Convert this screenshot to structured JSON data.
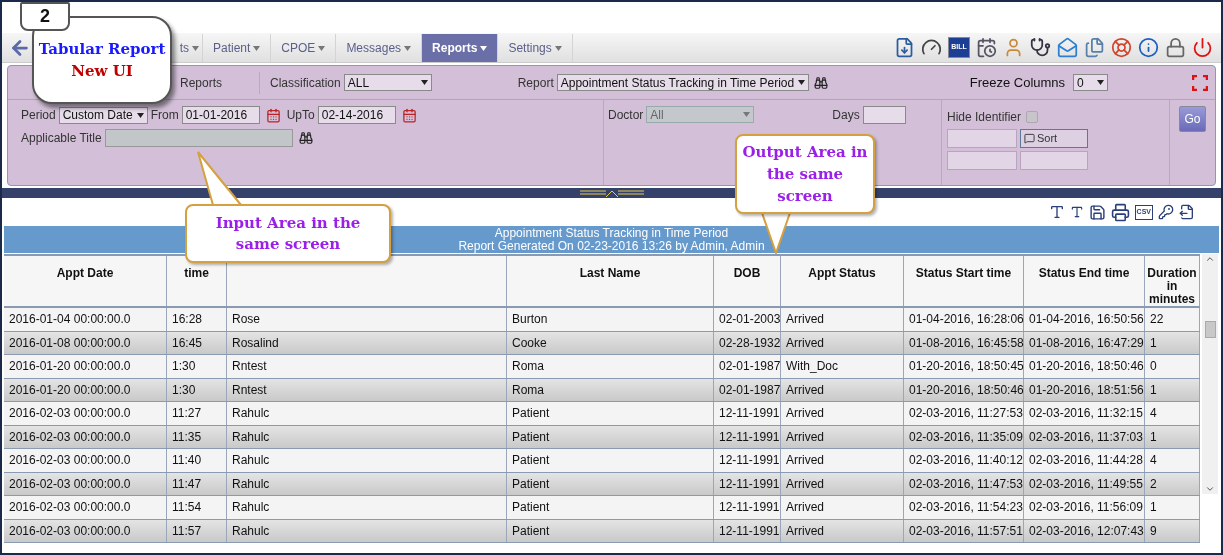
{
  "callouts": {
    "badge": "2",
    "main": {
      "title": "Tabular Report",
      "subtitle": "New UI"
    },
    "input": "Input Area in the same screen",
    "output": "Output Area in the same screen"
  },
  "nav": {
    "tabs": [
      {
        "label": "ts",
        "selected": false
      },
      {
        "label": "Patient",
        "selected": false
      },
      {
        "label": "CPOE",
        "selected": false
      },
      {
        "label": "Messages",
        "selected": false
      },
      {
        "label": "Reports",
        "selected": true
      },
      {
        "label": "Settings",
        "selected": false
      }
    ],
    "bill_label": "BILL"
  },
  "filters": {
    "reports_label": "Reports",
    "classification": {
      "label": "Classification",
      "value": "ALL"
    },
    "report": {
      "label": "Report",
      "value": "Appointment Status Tracking in Time Period"
    },
    "freeze": {
      "label": "Freeze Columns",
      "value": "0"
    },
    "period": {
      "label": "Period",
      "value": "Custom Date"
    },
    "from": {
      "label": "From",
      "value": "01-01-2016"
    },
    "upto": {
      "label": "UpTo",
      "value": "02-14-2016"
    },
    "applicable_title": {
      "label": "Applicable Title",
      "disabled": true
    },
    "doctor": {
      "label": "Doctor",
      "value": "All",
      "disabled": true
    },
    "days": {
      "label": "Days"
    },
    "hide_identifier": {
      "label": "Hide Identifier",
      "checked": false
    },
    "buttons": [
      {
        "disabled": true
      },
      {
        "label": "Sort",
        "disabled": false
      },
      {
        "disabled": true
      },
      {
        "disabled": true
      }
    ],
    "go": "Go"
  },
  "report": {
    "title": "Appointment Status Tracking in Time Period",
    "subtitle": "Report Generated On 02-23-2016 13:26 by Admin, Admin",
    "csv_label": "CSV",
    "columns": [
      {
        "label": "Appt Date"
      },
      {
        "label": "time"
      },
      {},
      {
        "label": "Last Name"
      },
      {
        "label": "DOB"
      },
      {
        "label": "Appt Status"
      },
      {
        "label": "Status Start time"
      },
      {
        "label": "Status End time"
      },
      {
        "label": "Duration in minutes"
      }
    ],
    "rows": [
      [
        "2016-01-04 00:00:00.0",
        "16:28",
        "Rose",
        "Burton",
        "02-01-2003",
        "Arrived",
        "01-04-2016, 16:28:06",
        "01-04-2016, 16:50:56",
        "22"
      ],
      [
        "2016-01-08 00:00:00.0",
        "16:45",
        "Rosalind",
        "Cooke",
        "02-28-1932",
        "Arrived",
        "01-08-2016, 16:45:58",
        "01-08-2016, 16:47:29",
        "1"
      ],
      [
        "2016-01-20 00:00:00.0",
        "1:30",
        "Rntest",
        "Roma",
        "02-01-1987",
        "With_Doc",
        "01-20-2016, 18:50:45",
        "01-20-2016, 18:50:46",
        "0"
      ],
      [
        "2016-01-20 00:00:00.0",
        "1:30",
        "Rntest",
        "Roma",
        "02-01-1987",
        "Arrived",
        "01-20-2016, 18:50:46",
        "01-20-2016, 18:51:56",
        "1"
      ],
      [
        "2016-02-03 00:00:00.0",
        "11:27",
        "Rahulc",
        "Patient",
        "12-11-1991",
        "Arrived",
        "02-03-2016, 11:27:53",
        "02-03-2016, 11:32:15",
        "4"
      ],
      [
        "2016-02-03 00:00:00.0",
        "11:35",
        "Rahulc",
        "Patient",
        "12-11-1991",
        "Arrived",
        "02-03-2016, 11:35:09",
        "02-03-2016, 11:37:03",
        "1"
      ],
      [
        "2016-02-03 00:00:00.0",
        "11:40",
        "Rahulc",
        "Patient",
        "12-11-1991",
        "Arrived",
        "02-03-2016, 11:40:12",
        "02-03-2016, 11:44:28",
        "4"
      ],
      [
        "2016-02-03 00:00:00.0",
        "11:47",
        "Rahulc",
        "Patient",
        "12-11-1991",
        "Arrived",
        "02-03-2016, 11:47:53",
        "02-03-2016, 11:49:55",
        "2"
      ],
      [
        "2016-02-03 00:00:00.0",
        "11:54",
        "Rahulc",
        "Patient",
        "12-11-1991",
        "Arrived",
        "02-03-2016, 11:54:23",
        "02-03-2016, 11:56:09",
        "1"
      ],
      [
        "2016-02-03 00:00:00.0",
        "11:57",
        "Rahulc",
        "Patient",
        "12-11-1991",
        "Arrived",
        "02-03-2016, 11:57:51",
        "02-03-2016, 12:07:43",
        "9"
      ]
    ]
  }
}
